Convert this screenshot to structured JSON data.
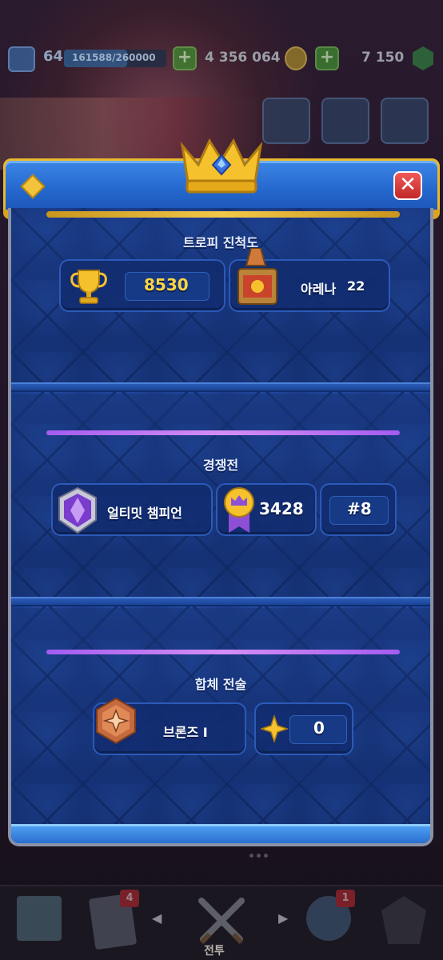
{
  "status_bar": {
    "level": "64",
    "xp": "161588/260000",
    "xp_progress": 0.62,
    "gold": "4 356 064",
    "gems": "7 150"
  },
  "modal": {
    "trophy_section": {
      "title": "트로피 진척도",
      "trophies": "8530",
      "arena_label": "아레나",
      "arena_number": "22"
    },
    "ranked_section": {
      "title": "경쟁전",
      "league": "얼티밋 챔피언",
      "rating": "3428",
      "rank": "#8"
    },
    "merge_section": {
      "title": "합체 전술",
      "league": "브론즈 I",
      "points": "0"
    }
  },
  "bottom_nav": {
    "cards_badge": "4",
    "battle_label": "전투",
    "social_badge": "1"
  },
  "colors": {
    "accent_gold": "#fbd545",
    "panel_blue": "#1f3f88",
    "close_red": "#d63232"
  }
}
